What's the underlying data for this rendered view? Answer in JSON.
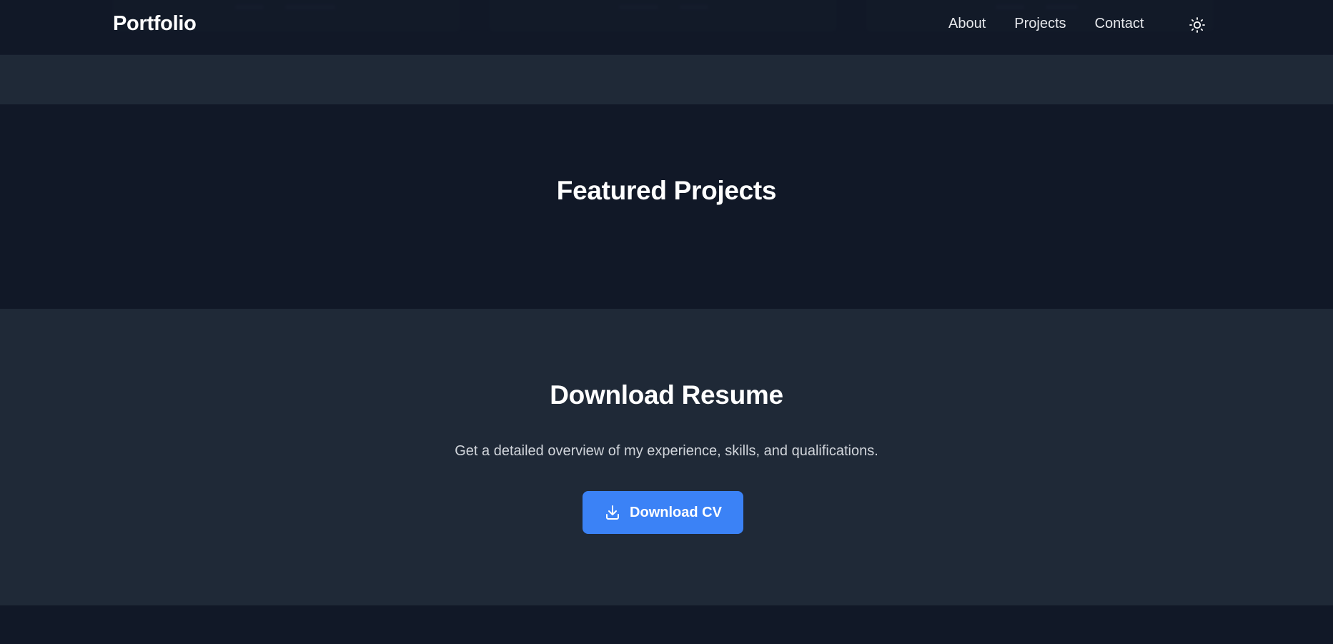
{
  "navbar": {
    "brand": "Portfolio",
    "links": [
      "About",
      "Projects",
      "Contact"
    ],
    "theme_toggle_icon": "sun-icon"
  },
  "featured": {
    "title": "Featured Projects"
  },
  "resume": {
    "title": "Download Resume",
    "description": "Get a detailed overview of my experience, skills, and qualifications.",
    "button_label": "Download CV",
    "button_icon": "download-icon"
  },
  "colors": {
    "background": "#111827",
    "section_alt": "#1f2937",
    "accent": "#3b82f6",
    "text": "#ffffff",
    "muted_text": "#d1d5db"
  }
}
